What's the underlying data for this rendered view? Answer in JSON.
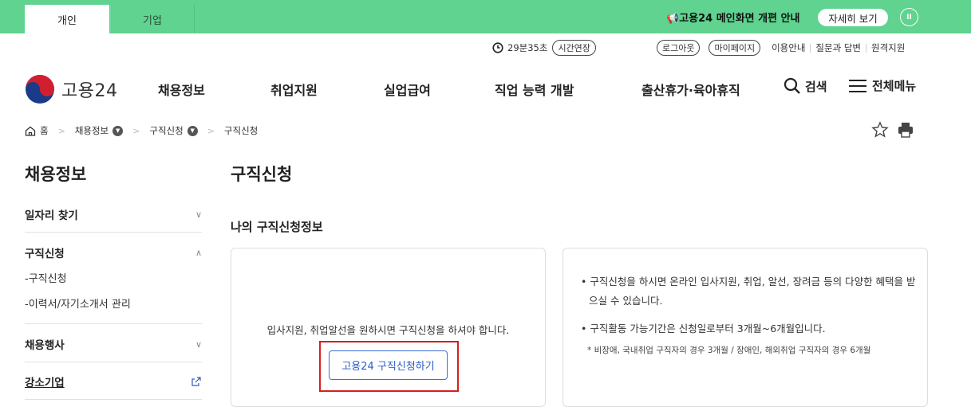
{
  "topbar": {
    "tab_personal": "개인",
    "tab_corporate": "기업",
    "notice": "고용24 메인화면 개편 안내",
    "notice_button": "자세히 보기",
    "pause_label": "II"
  },
  "util": {
    "timer": "29분35초",
    "extend": "시간연장",
    "logout": "로그아웃",
    "mypage": "마이페이지",
    "guide": "이용안내",
    "qna": "질문과 답변",
    "remote": "원격지원"
  },
  "header": {
    "logo_text": "고용24",
    "nav": [
      "채용정보",
      "취업지원",
      "실업급여",
      "직업 능력 개발",
      "출산휴가·육아휴직"
    ],
    "search": "검색",
    "all_menu": "전체메뉴"
  },
  "breadcrumb": [
    "홈",
    "채용정보",
    "구직신청",
    "구직신청"
  ],
  "sidebar": {
    "title": "채용정보",
    "items": [
      {
        "label": "일자리 찾기"
      },
      {
        "label": "구직신청"
      },
      {
        "label": "채용행사"
      },
      {
        "label": "강소기업"
      }
    ],
    "subitems": [
      "-구직신청",
      "-이력서/자기소개서 관리"
    ]
  },
  "main": {
    "title": "구직신청",
    "section_title": "나의 구직신청정보",
    "left_text": "입사지원, 취업알선을 원하시면 구직신청을 하셔야 합니다.",
    "apply_button": "고용24 구직신청하기",
    "bullets": [
      "구직신청을 하시면 온라인 입사지원, 취업, 알선, 장려금 등의 다양한 혜택을 받으실 수 있습니다.",
      "구직활동 가능기간은 신청일로부터 3개월~6개월입니다."
    ],
    "note": "* 비장애, 국내취업 구직자의 경우 3개월 / 장애인, 해외취업 구직자의 경우 6개월"
  },
  "colors": {
    "brand_green": "#5fd38f",
    "button_blue": "#2b5cc8",
    "highlight_red": "#d62020"
  }
}
